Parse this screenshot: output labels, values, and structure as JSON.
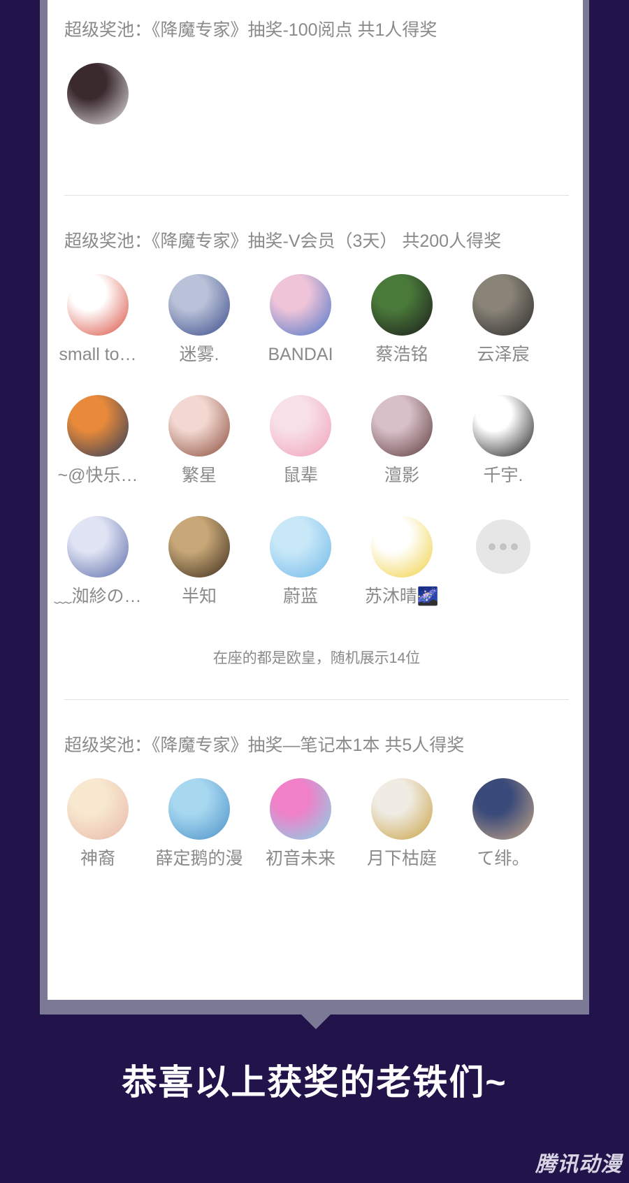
{
  "sections": [
    {
      "title": "超级奖池：《降魔专家》抽奖-100阅点 共1人得奖",
      "winners": [
        {
          "avatar_colors": [
            "#3a2a2e",
            "#e8e4e8"
          ],
          "icon": "white-cat-avatar"
        }
      ]
    },
    {
      "title": "超级奖池：《降魔专家》抽奖-V会员（3天） 共200人得奖",
      "winners": [
        {
          "name": "small to…",
          "avatar_colors": [
            "#ffffff",
            "#d84c3c"
          ],
          "icon": "toad-avatar"
        },
        {
          "name": "迷雾.",
          "avatar_colors": [
            "#b9c2d8",
            "#3a4a8a"
          ],
          "icon": "anime-girl-avatar"
        },
        {
          "name": "BANDAI",
          "avatar_colors": [
            "#f0c4d8",
            "#4a74c8"
          ],
          "icon": "anime-girl-avatar"
        },
        {
          "name": "蔡浩铭",
          "avatar_colors": [
            "#4a7a3a",
            "#1a1a1a"
          ],
          "icon": "kumamon-avatar"
        },
        {
          "name": "云泽宸",
          "avatar_colors": [
            "#8a8478",
            "#2a2a2a"
          ],
          "icon": "street-avatar"
        },
        {
          "name": "~@快乐…",
          "avatar_colors": [
            "#e88a3a",
            "#2a3a5a"
          ],
          "icon": "sunset-road-avatar"
        },
        {
          "name": "繁星",
          "avatar_colors": [
            "#f2d8d0",
            "#8a4a3a"
          ],
          "icon": "anime-boy-avatar"
        },
        {
          "name": "鼠辈",
          "avatar_colors": [
            "#f8e0e8",
            "#f0a0b8"
          ],
          "icon": "pig-avatar"
        },
        {
          "name": "澶影",
          "avatar_colors": [
            "#d8c0c8",
            "#5a3a3a"
          ],
          "icon": "anime-boy-avatar"
        },
        {
          "name": "千宇.",
          "avatar_colors": [
            "#ffffff",
            "#1a1a1a"
          ],
          "icon": "ink-anime-avatar"
        },
        {
          "name": "﹏洳紾の…",
          "avatar_colors": [
            "#e0e4f4",
            "#5a6aa8"
          ],
          "icon": "anime-girl-avatar"
        },
        {
          "name": "半知",
          "avatar_colors": [
            "#c8a878",
            "#3a2a1a"
          ],
          "icon": "room-avatar"
        },
        {
          "name": "蔚蓝",
          "avatar_colors": [
            "#c8e8f8",
            "#70b8e8"
          ],
          "icon": "heart-cloud-avatar"
        },
        {
          "name": "苏沐晴🌌",
          "avatar_colors": [
            "#ffffff",
            "#f0d040"
          ],
          "icon": "anime-girl-avatar"
        }
      ],
      "more_icon": "more-dots-icon",
      "footnote": "在座的都是欧皇，随机展示14位"
    },
    {
      "title": "超级奖池：《降魔专家》抽奖—笔记本1本 共5人得奖",
      "winners": [
        {
          "name": "神裔",
          "avatar_colors": [
            "#f8e8d0",
            "#e8b8a8"
          ],
          "icon": "chibi-girl-avatar"
        },
        {
          "name": "薛定鹅的漫",
          "avatar_colors": [
            "#a8d8f0",
            "#4a90c8"
          ],
          "icon": "cartoon-avatar"
        },
        {
          "name": "初音未来",
          "avatar_colors": [
            "#f080c8",
            "#80d8e8"
          ],
          "icon": "miku-avatar"
        },
        {
          "name": "月下枯庭",
          "avatar_colors": [
            "#f0ece4",
            "#c8a040"
          ],
          "icon": "figure-avatar"
        },
        {
          "name": "て绯。",
          "avatar_colors": [
            "#3a4a7a",
            "#c8a888"
          ],
          "icon": "street-avatar"
        }
      ]
    }
  ],
  "congrats": "恭喜以上获奖的老铁们~",
  "watermark": "腾讯动漫"
}
